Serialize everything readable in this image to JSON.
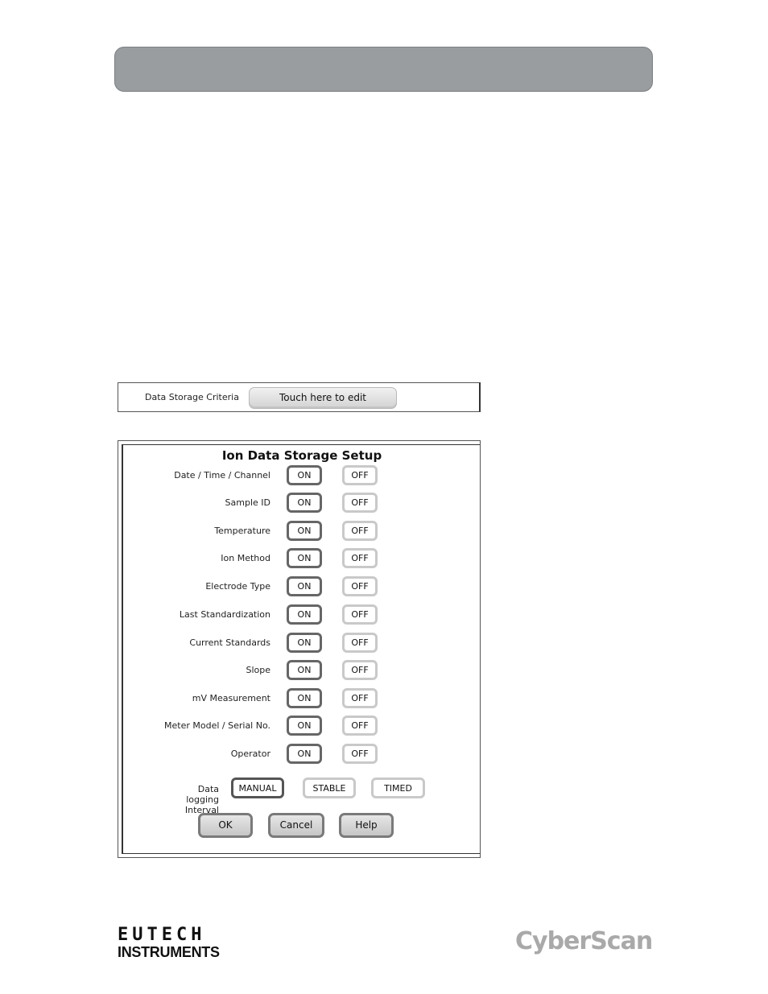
{
  "criteria": {
    "label": "Data Storage Criteria",
    "edit_button": "Touch here to edit"
  },
  "dialog": {
    "title": "Ion Data Storage Setup",
    "rows": [
      {
        "label": "Date / Time / Channel",
        "on": "ON",
        "off": "OFF"
      },
      {
        "label": "Sample ID",
        "on": "ON",
        "off": "OFF"
      },
      {
        "label": "Temperature",
        "on": "ON",
        "off": "OFF"
      },
      {
        "label": "Ion Method",
        "on": "ON",
        "off": "OFF"
      },
      {
        "label": "Electrode Type",
        "on": "ON",
        "off": "OFF"
      },
      {
        "label": "Last Standardization",
        "on": "ON",
        "off": "OFF"
      },
      {
        "label": "Current Standards",
        "on": "ON",
        "off": "OFF"
      },
      {
        "label": "Slope",
        "on": "ON",
        "off": "OFF"
      },
      {
        "label": "mV Measurement",
        "on": "ON",
        "off": "OFF"
      },
      {
        "label": "Meter  Model / Serial No.",
        "on": "ON",
        "off": "OFF"
      },
      {
        "label": "Operator",
        "on": "ON",
        "off": "OFF"
      }
    ],
    "interval_label": "Data logging Interval",
    "interval_options": [
      "MANUAL",
      "STABLE",
      "TIMED"
    ],
    "ok_button": "OK",
    "cancel_button": "Cancel",
    "help_button": "Help"
  },
  "footer": {
    "logo_top": "EUTECH",
    "logo_bottom": "INSTRUMENTS",
    "brand": "CyberScan"
  }
}
